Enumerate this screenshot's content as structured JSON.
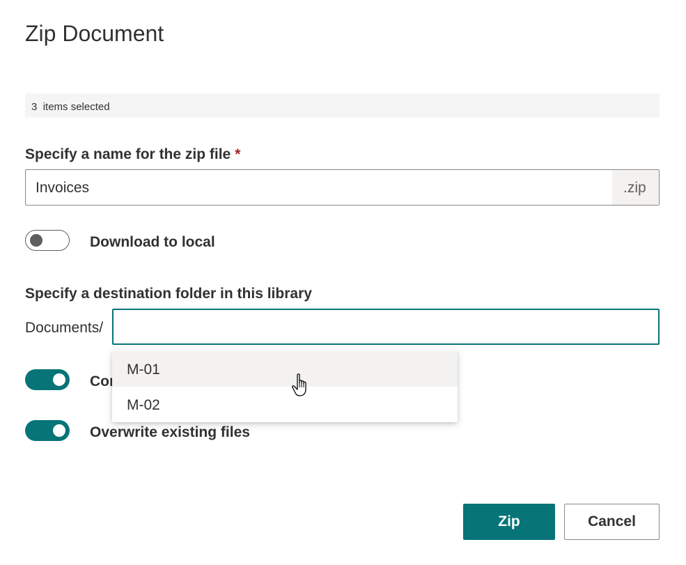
{
  "dialog": {
    "title": "Zip Document"
  },
  "selection": {
    "count": "3",
    "text": "items selected"
  },
  "zip_name": {
    "label": "Specify a name for the zip file",
    "required_mark": "*",
    "value": "Invoices",
    "suffix": ".zip"
  },
  "download_toggle": {
    "label": "Download to local",
    "state": "off"
  },
  "destination": {
    "label": "Specify a destination folder in this library",
    "prefix": "Documents/",
    "value": "",
    "suggestions": [
      "M-01",
      "M-02"
    ],
    "hovered_suggestion": "M-01"
  },
  "toggle_two": {
    "label": "Cor",
    "state": "on"
  },
  "overwrite_toggle": {
    "label": "Overwrite existing files",
    "state": "on"
  },
  "buttons": {
    "primary": "Zip",
    "secondary": "Cancel"
  },
  "colors": {
    "accent": "#077477",
    "required": "#a4262c",
    "text": "#323130"
  }
}
